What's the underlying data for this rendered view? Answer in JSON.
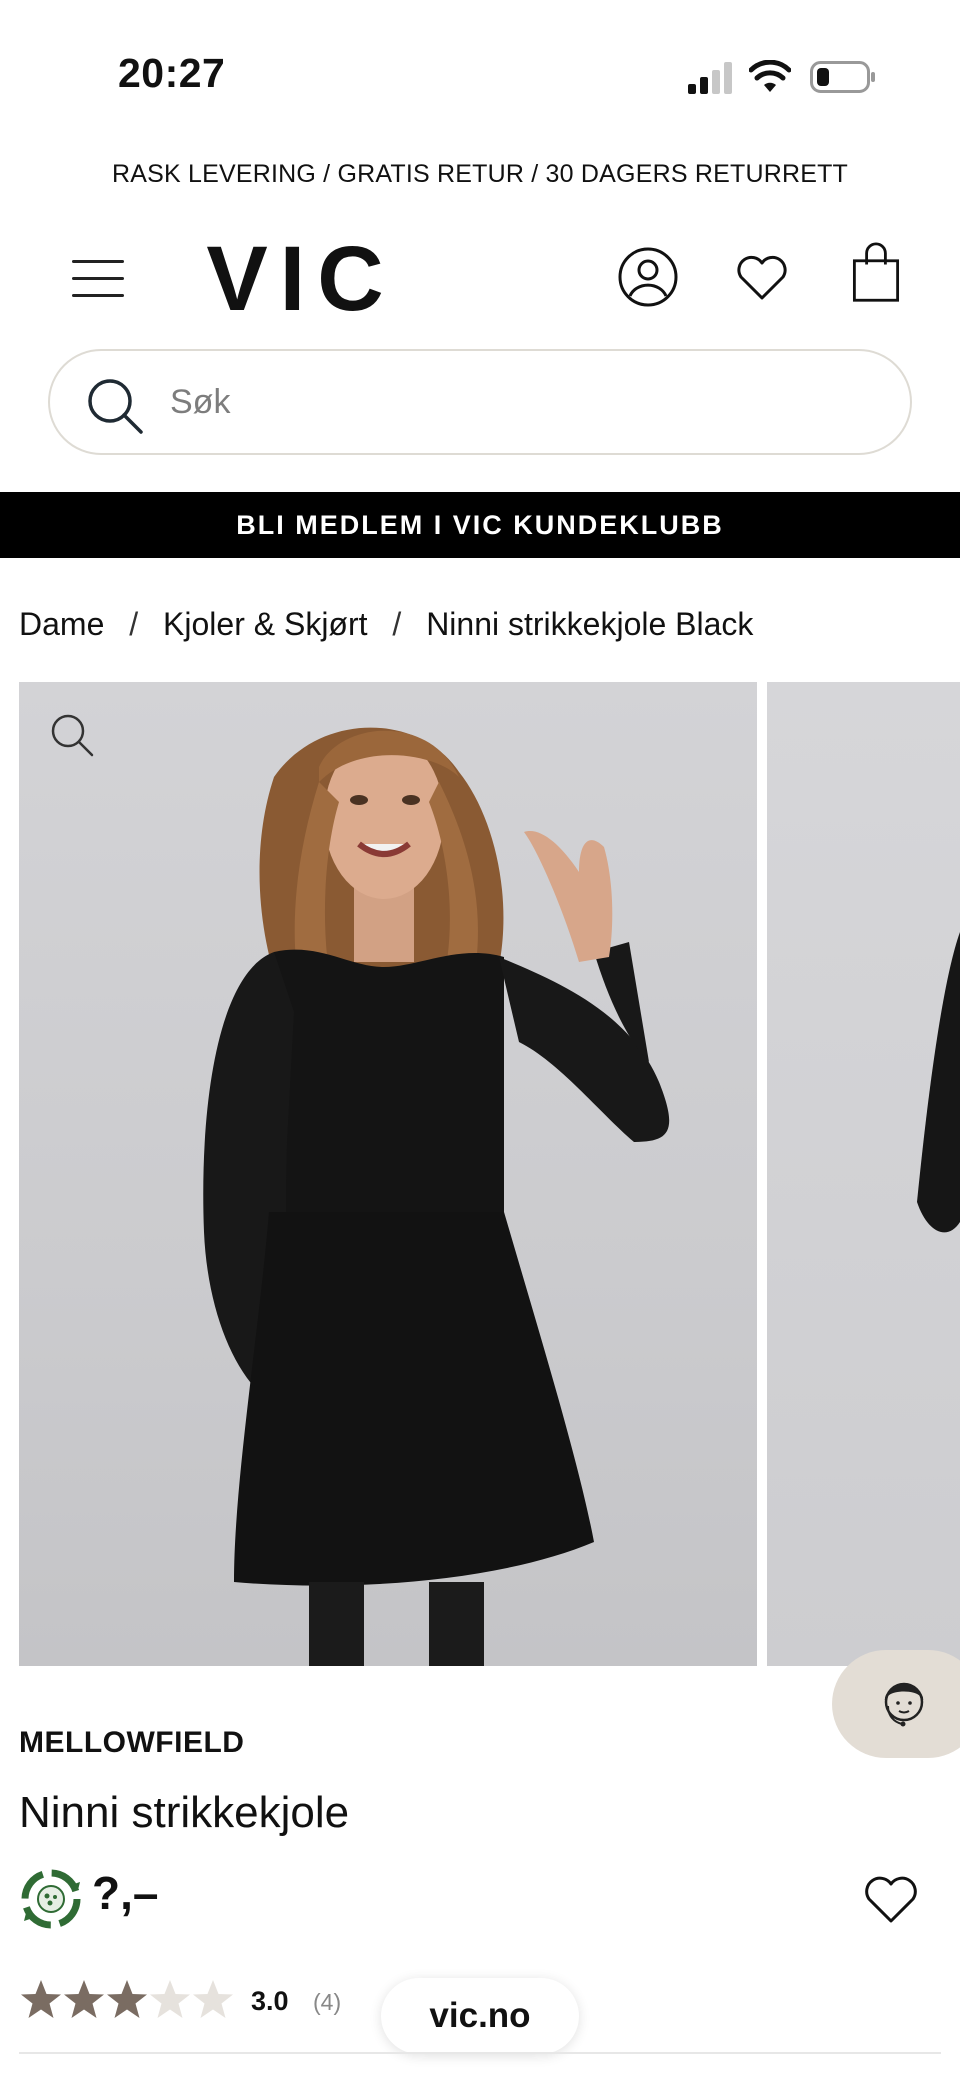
{
  "status_bar": {
    "time": "20:27",
    "icons": [
      "cellular-signal-icon",
      "wifi-icon",
      "battery-low-icon"
    ]
  },
  "promo": {
    "text": "RASK LEVERING / GRATIS RETUR / 30 DAGERS RETURRETT"
  },
  "header": {
    "logo_text": "VIC",
    "icons": [
      "menu-icon",
      "account-icon",
      "heart-icon",
      "shopping-bag-icon"
    ]
  },
  "search": {
    "placeholder": "Søk",
    "value": ""
  },
  "club_banner": {
    "text": "BLI MEDLEM I VIC KUNDEKLUBB"
  },
  "breadcrumb": {
    "items": [
      "Dame",
      "Kjoler & Skjørt",
      "Ninni strikkekjole Black"
    ],
    "separator": "/"
  },
  "gallery": {
    "images": [
      "product-photo-front",
      "product-photo-side"
    ],
    "icons": [
      "zoom-icon"
    ]
  },
  "chat": {
    "icon": "customer-service-icon"
  },
  "product": {
    "brand": "MELLOWFIELD",
    "name": "Ninni strikkekjole",
    "price": "?,–",
    "eco_icon": "recycle-badge-icon",
    "rating": {
      "value": "3.0",
      "count": "(4)",
      "stars_filled": 3,
      "stars_total": 5
    }
  },
  "browser": {
    "domain": "vic.no"
  },
  "colors": {
    "banner_bg": "#000000",
    "search_border": "#dedbd4",
    "chat_bg": "#e3ddd5",
    "star_filled": "#7a6c62",
    "star_empty": "#e6e2dd",
    "eco_green": "#2f6b34"
  }
}
